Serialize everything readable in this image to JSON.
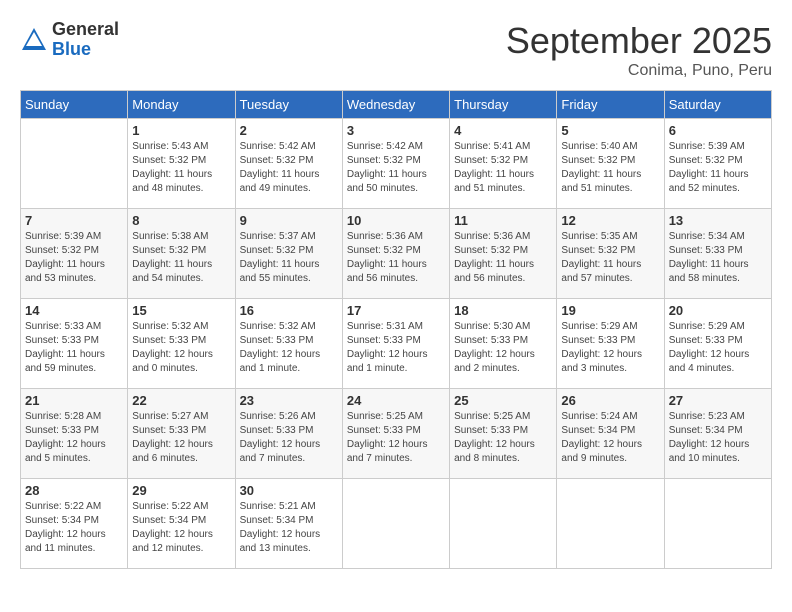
{
  "header": {
    "logo_general": "General",
    "logo_blue": "Blue",
    "month_title": "September 2025",
    "subtitle": "Conima, Puno, Peru"
  },
  "days_of_week": [
    "Sunday",
    "Monday",
    "Tuesday",
    "Wednesday",
    "Thursday",
    "Friday",
    "Saturday"
  ],
  "weeks": [
    [
      {
        "day": "",
        "sunrise": "",
        "sunset": "",
        "daylight": ""
      },
      {
        "day": "1",
        "sunrise": "Sunrise: 5:43 AM",
        "sunset": "Sunset: 5:32 PM",
        "daylight": "Daylight: 11 hours and 48 minutes."
      },
      {
        "day": "2",
        "sunrise": "Sunrise: 5:42 AM",
        "sunset": "Sunset: 5:32 PM",
        "daylight": "Daylight: 11 hours and 49 minutes."
      },
      {
        "day": "3",
        "sunrise": "Sunrise: 5:42 AM",
        "sunset": "Sunset: 5:32 PM",
        "daylight": "Daylight: 11 hours and 50 minutes."
      },
      {
        "day": "4",
        "sunrise": "Sunrise: 5:41 AM",
        "sunset": "Sunset: 5:32 PM",
        "daylight": "Daylight: 11 hours and 51 minutes."
      },
      {
        "day": "5",
        "sunrise": "Sunrise: 5:40 AM",
        "sunset": "Sunset: 5:32 PM",
        "daylight": "Daylight: 11 hours and 51 minutes."
      },
      {
        "day": "6",
        "sunrise": "Sunrise: 5:39 AM",
        "sunset": "Sunset: 5:32 PM",
        "daylight": "Daylight: 11 hours and 52 minutes."
      }
    ],
    [
      {
        "day": "7",
        "sunrise": "Sunrise: 5:39 AM",
        "sunset": "Sunset: 5:32 PM",
        "daylight": "Daylight: 11 hours and 53 minutes."
      },
      {
        "day": "8",
        "sunrise": "Sunrise: 5:38 AM",
        "sunset": "Sunset: 5:32 PM",
        "daylight": "Daylight: 11 hours and 54 minutes."
      },
      {
        "day": "9",
        "sunrise": "Sunrise: 5:37 AM",
        "sunset": "Sunset: 5:32 PM",
        "daylight": "Daylight: 11 hours and 55 minutes."
      },
      {
        "day": "10",
        "sunrise": "Sunrise: 5:36 AM",
        "sunset": "Sunset: 5:32 PM",
        "daylight": "Daylight: 11 hours and 56 minutes."
      },
      {
        "day": "11",
        "sunrise": "Sunrise: 5:36 AM",
        "sunset": "Sunset: 5:32 PM",
        "daylight": "Daylight: 11 hours and 56 minutes."
      },
      {
        "day": "12",
        "sunrise": "Sunrise: 5:35 AM",
        "sunset": "Sunset: 5:32 PM",
        "daylight": "Daylight: 11 hours and 57 minutes."
      },
      {
        "day": "13",
        "sunrise": "Sunrise: 5:34 AM",
        "sunset": "Sunset: 5:33 PM",
        "daylight": "Daylight: 11 hours and 58 minutes."
      }
    ],
    [
      {
        "day": "14",
        "sunrise": "Sunrise: 5:33 AM",
        "sunset": "Sunset: 5:33 PM",
        "daylight": "Daylight: 11 hours and 59 minutes."
      },
      {
        "day": "15",
        "sunrise": "Sunrise: 5:32 AM",
        "sunset": "Sunset: 5:33 PM",
        "daylight": "Daylight: 12 hours and 0 minutes."
      },
      {
        "day": "16",
        "sunrise": "Sunrise: 5:32 AM",
        "sunset": "Sunset: 5:33 PM",
        "daylight": "Daylight: 12 hours and 1 minute."
      },
      {
        "day": "17",
        "sunrise": "Sunrise: 5:31 AM",
        "sunset": "Sunset: 5:33 PM",
        "daylight": "Daylight: 12 hours and 1 minute."
      },
      {
        "day": "18",
        "sunrise": "Sunrise: 5:30 AM",
        "sunset": "Sunset: 5:33 PM",
        "daylight": "Daylight: 12 hours and 2 minutes."
      },
      {
        "day": "19",
        "sunrise": "Sunrise: 5:29 AM",
        "sunset": "Sunset: 5:33 PM",
        "daylight": "Daylight: 12 hours and 3 minutes."
      },
      {
        "day": "20",
        "sunrise": "Sunrise: 5:29 AM",
        "sunset": "Sunset: 5:33 PM",
        "daylight": "Daylight: 12 hours and 4 minutes."
      }
    ],
    [
      {
        "day": "21",
        "sunrise": "Sunrise: 5:28 AM",
        "sunset": "Sunset: 5:33 PM",
        "daylight": "Daylight: 12 hours and 5 minutes."
      },
      {
        "day": "22",
        "sunrise": "Sunrise: 5:27 AM",
        "sunset": "Sunset: 5:33 PM",
        "daylight": "Daylight: 12 hours and 6 minutes."
      },
      {
        "day": "23",
        "sunrise": "Sunrise: 5:26 AM",
        "sunset": "Sunset: 5:33 PM",
        "daylight": "Daylight: 12 hours and 7 minutes."
      },
      {
        "day": "24",
        "sunrise": "Sunrise: 5:25 AM",
        "sunset": "Sunset: 5:33 PM",
        "daylight": "Daylight: 12 hours and 7 minutes."
      },
      {
        "day": "25",
        "sunrise": "Sunrise: 5:25 AM",
        "sunset": "Sunset: 5:33 PM",
        "daylight": "Daylight: 12 hours and 8 minutes."
      },
      {
        "day": "26",
        "sunrise": "Sunrise: 5:24 AM",
        "sunset": "Sunset: 5:34 PM",
        "daylight": "Daylight: 12 hours and 9 minutes."
      },
      {
        "day": "27",
        "sunrise": "Sunrise: 5:23 AM",
        "sunset": "Sunset: 5:34 PM",
        "daylight": "Daylight: 12 hours and 10 minutes."
      }
    ],
    [
      {
        "day": "28",
        "sunrise": "Sunrise: 5:22 AM",
        "sunset": "Sunset: 5:34 PM",
        "daylight": "Daylight: 12 hours and 11 minutes."
      },
      {
        "day": "29",
        "sunrise": "Sunrise: 5:22 AM",
        "sunset": "Sunset: 5:34 PM",
        "daylight": "Daylight: 12 hours and 12 minutes."
      },
      {
        "day": "30",
        "sunrise": "Sunrise: 5:21 AM",
        "sunset": "Sunset: 5:34 PM",
        "daylight": "Daylight: 12 hours and 13 minutes."
      },
      {
        "day": "",
        "sunrise": "",
        "sunset": "",
        "daylight": ""
      },
      {
        "day": "",
        "sunrise": "",
        "sunset": "",
        "daylight": ""
      },
      {
        "day": "",
        "sunrise": "",
        "sunset": "",
        "daylight": ""
      },
      {
        "day": "",
        "sunrise": "",
        "sunset": "",
        "daylight": ""
      }
    ]
  ]
}
